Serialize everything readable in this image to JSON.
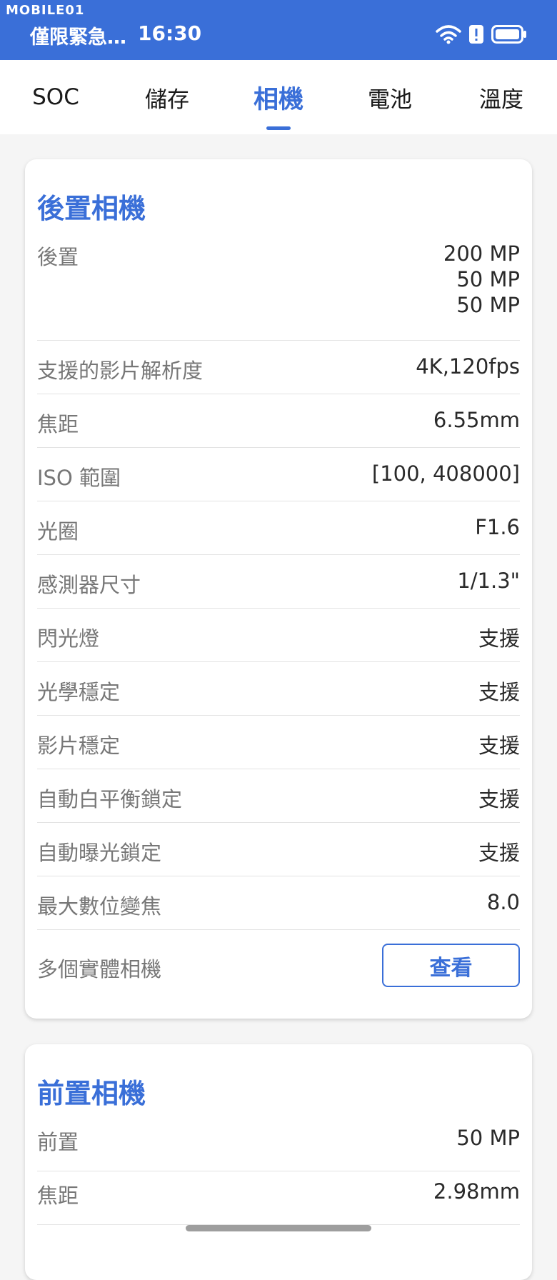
{
  "status_bar": {
    "watermark": "MOBILE01",
    "carrier": "僅限緊急…",
    "time": "16:30",
    "icons": [
      "wifi-icon",
      "alert-icon",
      "battery-icon"
    ],
    "color": "#3a6fd8"
  },
  "tabs": [
    {
      "label": "SOC",
      "active": false
    },
    {
      "label": "儲存",
      "active": false
    },
    {
      "label": "相機",
      "active": true
    },
    {
      "label": "電池",
      "active": false
    },
    {
      "label": "溫度",
      "active": false
    }
  ],
  "rear_camera": {
    "title": "後置相機",
    "rows": [
      {
        "label": "後置",
        "values": [
          "200 MP",
          "50 MP",
          "50 MP"
        ]
      },
      {
        "label": "支援的影片解析度",
        "value": "4K,120fps"
      },
      {
        "label": "焦距",
        "value": "6.55mm"
      },
      {
        "label": "ISO 範圍",
        "value": "[100, 408000]"
      },
      {
        "label": "光圈",
        "value": "F1.6"
      },
      {
        "label": "感測器尺寸",
        "value": "1/1.3\""
      },
      {
        "label": "閃光燈",
        "value": "支援"
      },
      {
        "label": "光學穩定",
        "value": "支援"
      },
      {
        "label": "影片穩定",
        "value": "支援"
      },
      {
        "label": "自動白平衡鎖定",
        "value": "支援"
      },
      {
        "label": "自動曝光鎖定",
        "value": "支援"
      },
      {
        "label": "最大數位變焦",
        "value": "8.0"
      },
      {
        "label": "多個實體相機",
        "button": "查看"
      }
    ]
  },
  "front_camera": {
    "title": "前置相機",
    "rows": [
      {
        "label": "前置",
        "value": "50 MP"
      },
      {
        "label": "焦距",
        "value": "2.98mm"
      }
    ]
  },
  "colors": {
    "accent": "#3a6fd8",
    "background": "#f5f5f5",
    "card": "#ffffff",
    "label": "#777777",
    "value": "#2a2a2a"
  }
}
